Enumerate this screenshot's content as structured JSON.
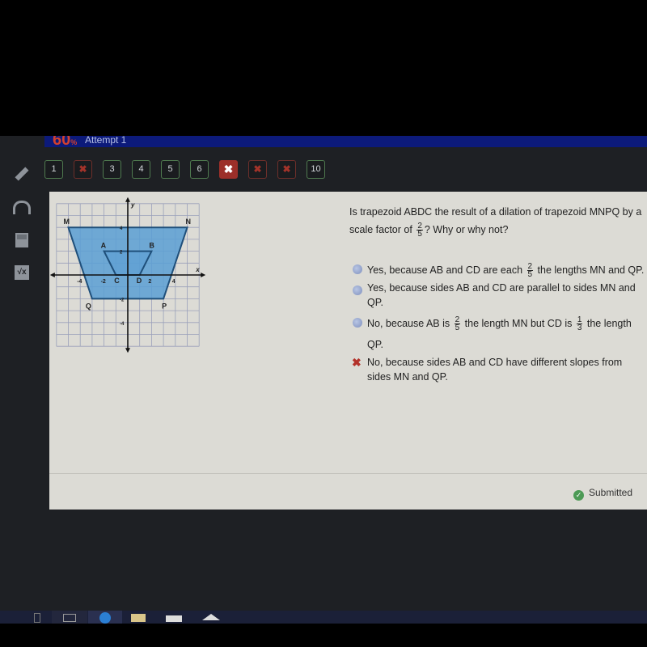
{
  "header": {
    "score": "60",
    "score_suffix": "%",
    "attempt_label": "Attempt 1"
  },
  "question_nav": [
    {
      "label": "1",
      "state": "answered"
    },
    {
      "label": "✖",
      "state": "wrong"
    },
    {
      "label": "3",
      "state": "answered"
    },
    {
      "label": "4",
      "state": "answered"
    },
    {
      "label": "5",
      "state": "answered"
    },
    {
      "label": "6",
      "state": "answered"
    },
    {
      "label": "✖",
      "state": "current-wrong"
    },
    {
      "label": "✖",
      "state": "wrong"
    },
    {
      "label": "✖",
      "state": "wrong"
    },
    {
      "label": "10",
      "state": "answered"
    }
  ],
  "tools": [
    {
      "name": "pencil-icon",
      "glyph": "✎"
    },
    {
      "name": "headphones-icon",
      "glyph": "🎧"
    },
    {
      "name": "calculator-icon",
      "glyph": "▦"
    },
    {
      "name": "formula-sheet-icon",
      "glyph": "√x"
    }
  ],
  "graph": {
    "x_axis_label": "x",
    "y_axis_label": "y",
    "range": [
      -6,
      6
    ],
    "tick_labels": {
      "x": [
        "-4",
        "-2",
        "2",
        "4"
      ],
      "y": [
        "4",
        "2",
        "-2",
        "-4"
      ]
    },
    "trapezoid_outer": {
      "name": "MNPQ",
      "points": [
        {
          "label": "M",
          "x": -5,
          "y": 4
        },
        {
          "label": "N",
          "x": 5,
          "y": 4
        },
        {
          "label": "P",
          "x": 3,
          "y": -2
        },
        {
          "label": "Q",
          "x": -3,
          "y": -2
        }
      ]
    },
    "trapezoid_inner": {
      "name": "ABDC",
      "points": [
        {
          "label": "A",
          "x": -2,
          "y": 2
        },
        {
          "label": "B",
          "x": 2,
          "y": 2
        },
        {
          "label": "D",
          "x": 1,
          "y": 0
        },
        {
          "label": "C",
          "x": -1,
          "y": 0
        }
      ]
    },
    "fill_color": "#5b9fd4",
    "stroke_color": "#1f4f7a"
  },
  "question": {
    "text_before": "Is trapezoid ABDC the result of a dilation of trapezoid MNPQ by a scale factor of",
    "frac": {
      "num": "2",
      "den": "5"
    },
    "text_after": "? Why or why not?"
  },
  "options": [
    {
      "parts": [
        "Yes, because AB and CD are each",
        {
          "num": "2",
          "den": "5"
        },
        "the lengths MN and QP."
      ],
      "state": "unselected"
    },
    {
      "parts": [
        "Yes, because sides AB and CD are parallel to sides MN and QP."
      ],
      "state": "unselected"
    },
    {
      "parts": [
        "No, because AB is",
        {
          "num": "2",
          "den": "5"
        },
        "the length MN but CD is",
        {
          "num": "1",
          "den": "3"
        },
        "the length QP."
      ],
      "state": "unselected"
    },
    {
      "parts": [
        "No, because sides AB and CD have different slopes from sides MN and QP."
      ],
      "state": "selected-incorrect"
    }
  ],
  "status": {
    "label": "Submitted"
  }
}
